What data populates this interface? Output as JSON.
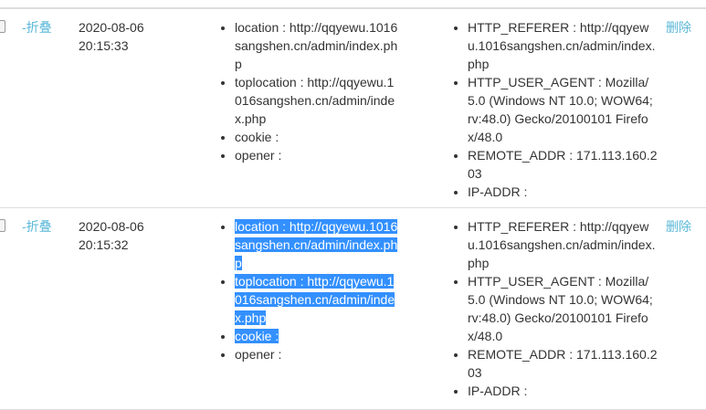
{
  "rows": [
    {
      "fold_label": "-折叠",
      "date": "2020-08-06",
      "time": "20:15:33",
      "client": [
        "location : http://qqyewu.1016sangshen.cn/admin/index.php",
        "toplocation : http://qqyewu.1016sangshen.cn/admin/index.php",
        "cookie :",
        "opener :"
      ],
      "server": [
        "HTTP_REFERER : http://qqyewu.1016sangshen.cn/admin/index.php",
        "HTTP_USER_AGENT : Mozilla/5.0 (Windows NT 10.0; WOW64; rv:48.0) Gecko/20100101 Firefox/48.0",
        "REMOTE_ADDR : 171.113.160.203",
        "IP-ADDR :"
      ],
      "delete_label": "删除"
    },
    {
      "fold_label": "-折叠",
      "date": "2020-08-06",
      "time": "20:15:32",
      "client": [
        "location : http://qqyewu.1016sangshen.cn/admin/index.php",
        "toplocation : http://qqyewu.1016sangshen.cn/admin/index.php",
        "cookie :",
        "opener :"
      ],
      "server": [
        "HTTP_REFERER : http://qqyewu.1016sangshen.cn/admin/index.php",
        "HTTP_USER_AGENT : Mozilla/5.0 (Windows NT 10.0; WOW64; rv:48.0) Gecko/20100101 Firefox/48.0",
        "REMOTE_ADDR : 171.113.160.203",
        "IP-ADDR :"
      ],
      "delete_label": "删除"
    }
  ],
  "colors": {
    "link": "#5bb8d8",
    "selection": "#3390ff"
  }
}
